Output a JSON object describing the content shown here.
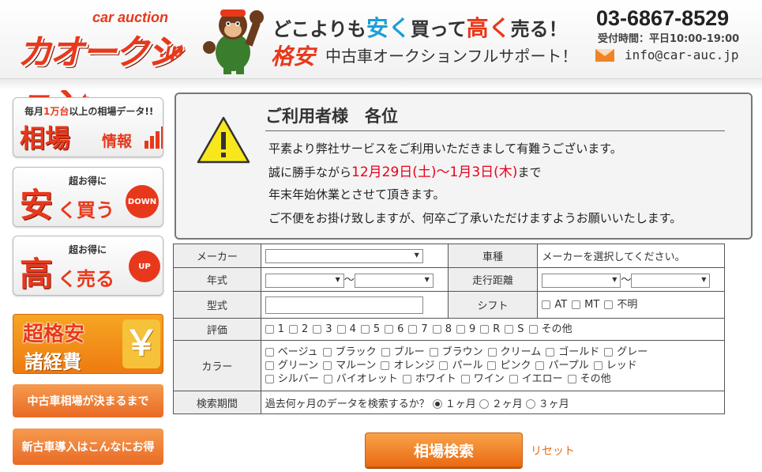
{
  "header": {
    "logo_main": "カオークション",
    "logo_sub": "car auction",
    "logo_jp": ".jp",
    "tagline1_a": "どこよりも",
    "tagline1_b": "安く",
    "tagline1_c": "買って",
    "tagline1_d": "高く",
    "tagline1_e": "売る！",
    "tag_yasu": "格安",
    "tagline2": "中古車オークションフルサポート！",
    "phone": "03-6867-8529",
    "hours": "受付時間：平日10:00-19:00",
    "email": "info@car-auc.jp"
  },
  "sidebar": {
    "soba_small_a": "毎月",
    "soba_small_b": "1万台",
    "soba_small_c": "以上の相場データ!!",
    "soba_big": "相場",
    "soba_mid": "情報",
    "buy_small": "超お得に",
    "buy_big": "安",
    "buy_mid": "く買う",
    "buy_badge": "DOWN",
    "sell_small": "超お得に",
    "sell_big": "高",
    "sell_mid": "く売る",
    "sell_badge": "UP",
    "fees_top": "超格安",
    "fees_bottom": "諸経費",
    "fees_icon": "￥",
    "market_link": "中古車相場が決まるまで",
    "import_link": "新古車導入はこんなにお得"
  },
  "notice": {
    "title": "ご利用者様　各位",
    "line1": "平素より弊社サービスをご利用いただきまして有難うございます。",
    "line2_a": "誠に勝手ながら",
    "line2_b": "12月29日(土)～1月3日(木)",
    "line2_c": "まで",
    "line3": "年末年始休業とさせて頂きます。",
    "line4": "ご不便をお掛け致しますが、何卒ご了承いただけますようお願いいたします。"
  },
  "search": {
    "maker_label": "メーカー",
    "model_label": "車種",
    "model_hint": "メーカーを選択してください。",
    "year_label": "年式",
    "tilde": "～",
    "mileage_label": "走行距離",
    "type_label": "型式",
    "shift_label": "シフト",
    "shift_options": [
      "AT",
      "MT",
      "不明"
    ],
    "grade_label": "評価",
    "grade_options": [
      "1",
      "2",
      "3",
      "4",
      "5",
      "6",
      "7",
      "8",
      "9",
      "R",
      "S",
      "その他"
    ],
    "color_label": "カラー",
    "color_row1": [
      "ベージュ",
      "ブラック",
      "ブルー",
      "ブラウン",
      "クリーム",
      "ゴールド",
      "グレー"
    ],
    "color_row2": [
      "グリーン",
      "マルーン",
      "オレンジ",
      "パール",
      "ピンク",
      "パープル",
      "レッド"
    ],
    "color_row3": [
      "シルバー",
      "バイオレット",
      "ホワイト",
      "ワイン",
      "イエロー",
      "その他"
    ],
    "period_label": "検索期間",
    "period_question": "過去何ヶ月のデータを検索するか？",
    "period_options": [
      "１ヶ月",
      "２ヶ月",
      "３ヶ月"
    ],
    "period_selected": 0,
    "submit_label": "相場検索",
    "reset_label": "リセット"
  },
  "colors": {
    "brand_red": "#e8381b",
    "accent_orange": "#ee7a11",
    "link_orange": "#e86a12",
    "notice_red": "#e8001c"
  }
}
